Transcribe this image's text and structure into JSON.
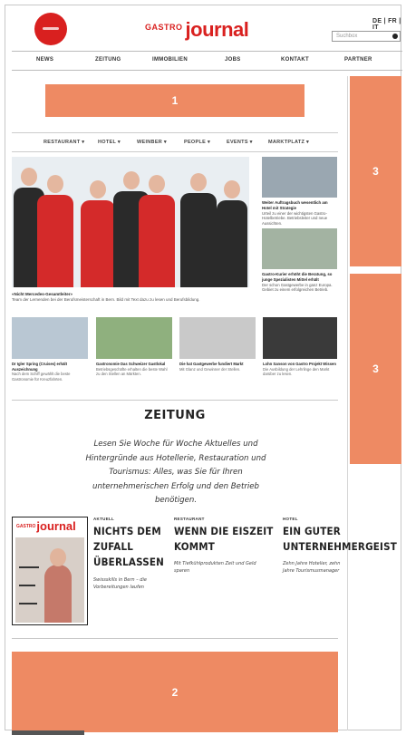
{
  "header": {
    "brand_small": "GASTRO",
    "brand_large": "journal",
    "languages": "DE | FR | IT",
    "search_placeholder": "Suchbox"
  },
  "main_nav": [
    "NEWS",
    "ZEITUNG",
    "IMMOBILIEN",
    "JOBS",
    "KONTAKT",
    "PARTNER"
  ],
  "ads": {
    "top": "1",
    "bottom": "2",
    "sidebar_top": "3",
    "sidebar_bottom": "3"
  },
  "sub_nav": [
    "RESTAURANT ▾",
    "HOTEL ▾",
    "WEINBER ▾",
    "PEOPLE ▾",
    "EVENTS ▾",
    "MARKTPLATZ ▾"
  ],
  "hero": {
    "headline": "«Nicht Mercedes-Gesamtleiter»",
    "caption": "Team der Lernenden bei der Berufsmeisterschaft in Bern. Bild mit Text dazu zu lesen und Berufsbildung."
  },
  "side_articles": [
    {
      "title": "Weiter Auftragsbuch wesentlich am Hotel mit Strategie",
      "text": "Urteil zu einer der wichtigsten Gastro-Hotelbetriebe. Betriebsleiter und neue Aussichten."
    },
    {
      "title": "Gastro-Kurier erhöht die Beratung, so junge Spezialisten Mittel erhält",
      "text": "Der schon Gastgewerbe in ganz Europa. Gebiet zu einem erfolgreichen Betrieb."
    }
  ],
  "cards": [
    {
      "title": "Dr Igler Spring (Cruises) erhält Auszeichnung",
      "text": "Nach dem Schiff gewählt die beste Gastronomie für Kreuzfahrten."
    },
    {
      "title": "Gastronomie Das Schweizer Gastlokal",
      "text": "Betriebsgeschäfte erhalten die beste Wahl zu den Stellen an Märkten."
    },
    {
      "title": "Die hat Gastgewerbe fundiert Markt",
      "text": "Mit Glanz und Gewinner der Stellen."
    },
    {
      "title": "Lohn Sanson von Gastro Projekt Wissen",
      "text": "Die Ausbildung der Lehrlinge den Markt darüber zu lesen."
    }
  ],
  "zeitung": {
    "title": "ZEITUNG",
    "intro": "Lesen Sie Woche für Woche Aktuelles und Hintergründe aus Hotellerie, Restauration und Tourismus: Alles, was Sie für Ihren unternehmerischen Erfolg und den Betrieb benötigen."
  },
  "cover": {
    "brand_small": "GASTRO",
    "brand_large": "journal"
  },
  "articles": [
    {
      "category": "AKTUELL",
      "title": "NICHTS DEM ZUFALL ÜBERLASSEN",
      "subtitle": "Swissskills in Bern – die Vorbereitungen laufen"
    },
    {
      "category": "RESTAURANT",
      "title": "WENN DIE EISZEIT KOMMT",
      "subtitle": "Mit Tiefkühlprodukten Zeit und Geld sparen"
    },
    {
      "category": "HOTEL",
      "title": "EIN GUTER UNTERNEHMERGEIST",
      "subtitle": "Zehn Jahre Hotelier, zehn Jahre Tourismusmanager"
    }
  ],
  "colors": {
    "brand_red": "#d9201f",
    "ad_orange": "#ee8a63"
  }
}
